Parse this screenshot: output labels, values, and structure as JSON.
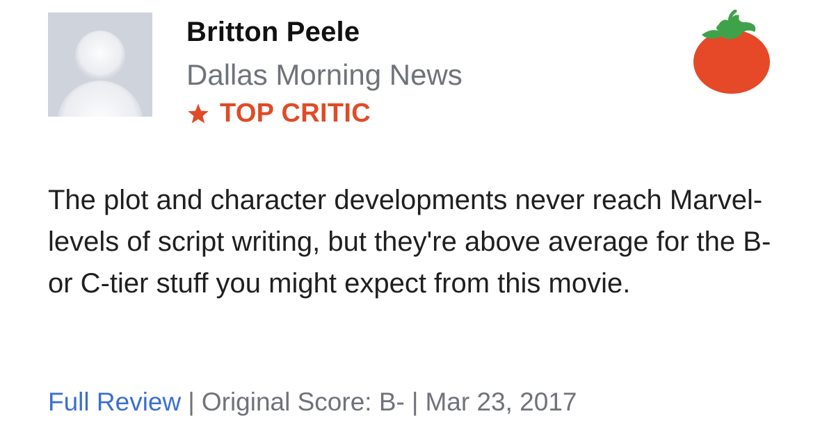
{
  "critic": {
    "name": "Britton Peele",
    "publication": "Dallas Morning News",
    "badge_label": "TOP CRITIC",
    "badge_icon": "star-icon",
    "avatar_icon": "default-avatar-icon"
  },
  "rating": {
    "icon": "fresh-tomato-icon",
    "state": "fresh"
  },
  "review": {
    "text": "The plot and character developments never reach Marvel-levels of script writing, but they're above average for the B- or C-tier stuff you might expect from this movie."
  },
  "footer": {
    "full_review_label": "Full Review",
    "separator": "|",
    "original_score": "Original Score: B-",
    "date": "Mar 23, 2017"
  },
  "colors": {
    "accent_red": "#e04b27",
    "link_blue": "#3b6fcf",
    "muted_gray": "#6f7379",
    "tomato_red": "#e54927",
    "leaf_green": "#3fa24a"
  }
}
